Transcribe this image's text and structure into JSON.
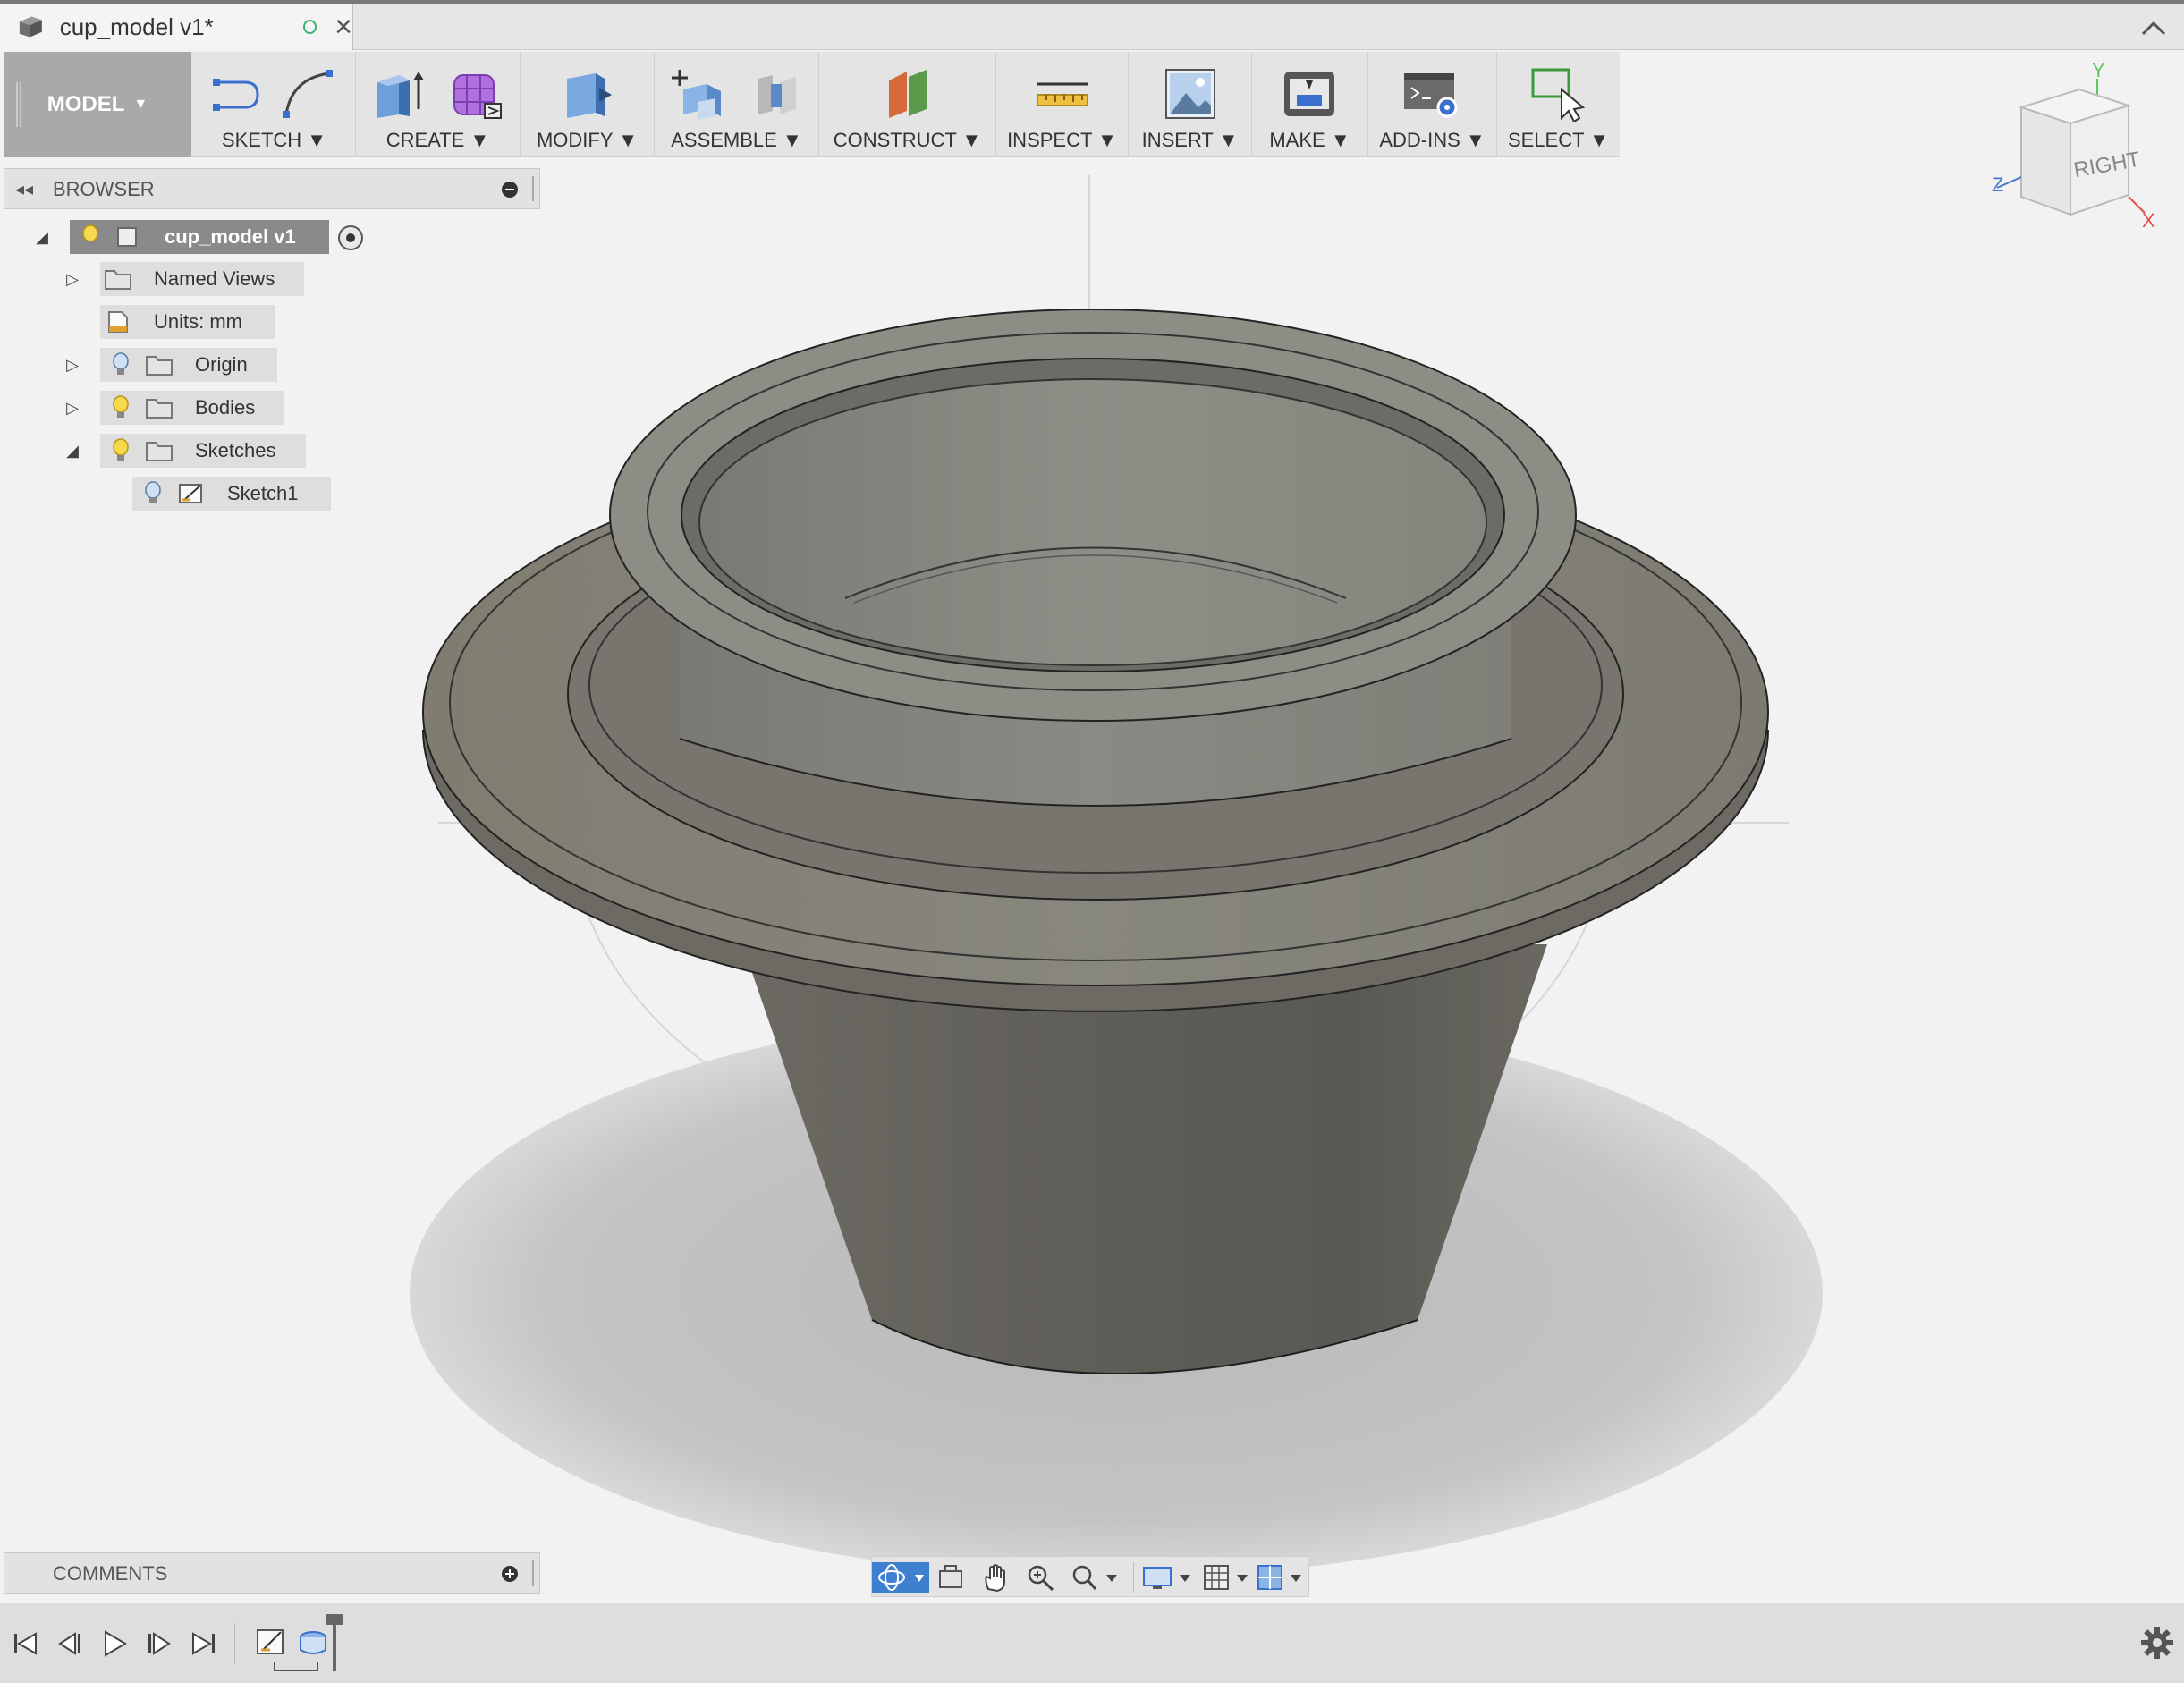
{
  "document": {
    "tab_title": "cup_model v1*"
  },
  "toolbar": {
    "workspace_label": "MODEL",
    "groups": [
      {
        "label": "SKETCH"
      },
      {
        "label": "CREATE"
      },
      {
        "label": "MODIFY"
      },
      {
        "label": "ASSEMBLE"
      },
      {
        "label": "CONSTRUCT"
      },
      {
        "label": "INSPECT"
      },
      {
        "label": "INSERT"
      },
      {
        "label": "MAKE"
      },
      {
        "label": "ADD-INS"
      },
      {
        "label": "SELECT"
      }
    ]
  },
  "browser": {
    "title": "BROWSER",
    "root": {
      "label": "cup_model v1"
    },
    "items": [
      {
        "label": "Named Views"
      },
      {
        "label": "Units: mm"
      },
      {
        "label": "Origin"
      },
      {
        "label": "Bodies"
      },
      {
        "label": "Sketches"
      },
      {
        "label": "Sketch1"
      }
    ]
  },
  "viewcube": {
    "face_label": "RIGHT",
    "axes": {
      "x": "X",
      "y": "Y",
      "z": "Z"
    },
    "axis_colors": {
      "x": "#e05050",
      "y": "#5cc85c",
      "z": "#4a78d0"
    }
  },
  "comments": {
    "title": "COMMENTS"
  },
  "colors": {
    "accent": "#3f7fd0",
    "model_body": "#76746c",
    "workspace_bg": "#a9a9a9"
  }
}
